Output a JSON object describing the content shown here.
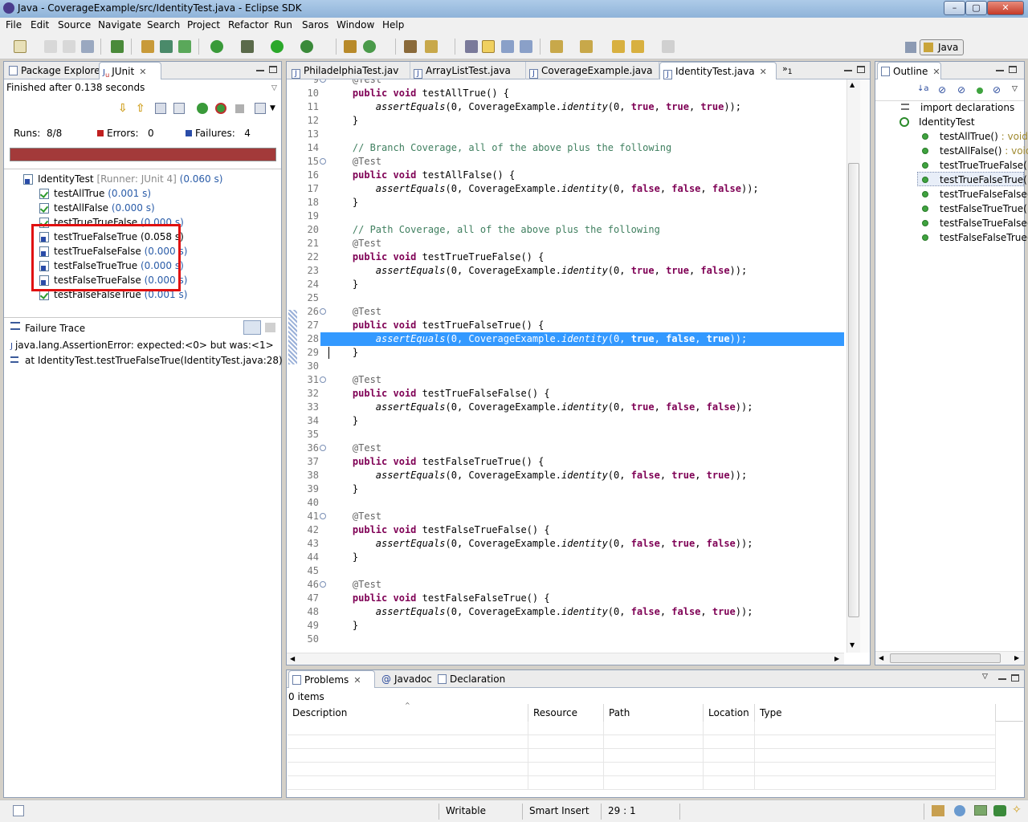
{
  "window": {
    "title": "Java - CoverageExample/src/IdentityTest.java - Eclipse SDK"
  },
  "menu": [
    "File",
    "Edit",
    "Source",
    "Navigate",
    "Search",
    "Project",
    "Refactor",
    "Run",
    "Saros",
    "Window",
    "Help"
  ],
  "perspective": {
    "label": "Java"
  },
  "junit": {
    "tabs": {
      "package_explorer": "Package Explorer",
      "junit": "JUnit"
    },
    "finished": "Finished after 0.138 seconds",
    "runs_label": "Runs:",
    "runs_value": "8/8",
    "errors_label": "Errors:",
    "errors_value": "0",
    "failures_label": "Failures:",
    "failures_value": "4",
    "progress_color": "#a33a3a",
    "root": {
      "name": "IdentityTest",
      "runner": "[Runner: JUnit 4]",
      "time": "(0.060 s)"
    },
    "tests": [
      {
        "name": "testAllTrue",
        "time": "(0.001 s)",
        "status": "pass"
      },
      {
        "name": "testAllFalse",
        "time": "(0.000 s)",
        "status": "pass"
      },
      {
        "name": "testTrueTrueFalse",
        "time": "(0.000 s)",
        "status": "pass"
      },
      {
        "name": "testTrueFalseTrue",
        "time": "(0.058 s)",
        "status": "fail"
      },
      {
        "name": "testTrueFalseFalse",
        "time": "(0.000 s)",
        "status": "fail"
      },
      {
        "name": "testFalseTrueTrue",
        "time": "(0.000 s)",
        "status": "fail"
      },
      {
        "name": "testFalseTrueFalse",
        "time": "(0.000 s)",
        "status": "fail"
      },
      {
        "name": "testFalseFalseTrue",
        "time": "(0.001 s)",
        "status": "pass"
      }
    ],
    "failure_trace": {
      "title": "Failure Trace",
      "lines": [
        "java.lang.AssertionError: expected:<0> but was:<1>",
        "at IdentityTest.testTrueFalseTrue(IdentityTest.java:28)"
      ]
    }
  },
  "editor": {
    "tabs": [
      "PhiladelphiaTest.jav",
      "ArrayListTest.java",
      "CoverageExample.java",
      "IdentityTest.java"
    ],
    "overflow_count": "1",
    "active_tab": 3,
    "highlight_line": 28
  },
  "outline": {
    "tab": "Outline",
    "import": "import declarations",
    "class": "IdentityTest",
    "methods": [
      {
        "name": "testAllTrue()",
        "ret": ": void"
      },
      {
        "name": "testAllFalse()",
        "ret": ": void"
      },
      {
        "name": "testTrueTrueFalse()",
        "ret": ""
      },
      {
        "name": "testTrueFalseTrue()",
        "ret": ""
      },
      {
        "name": "testTrueFalseFalse()",
        "ret": ""
      },
      {
        "name": "testFalseTrueTrue()",
        "ret": ""
      },
      {
        "name": "testFalseTrueFalse()",
        "ret": ""
      },
      {
        "name": "testFalseFalseTrue()",
        "ret": ""
      }
    ]
  },
  "problems": {
    "tabs": {
      "problems": "Problems",
      "javadoc": "Javadoc",
      "declaration": "Declaration"
    },
    "items": "0 items",
    "columns": [
      "Description",
      "Resource",
      "Path",
      "Location",
      "Type"
    ]
  },
  "status": {
    "writable": "Writable",
    "insert": "Smart Insert",
    "position": "29 : 1"
  }
}
